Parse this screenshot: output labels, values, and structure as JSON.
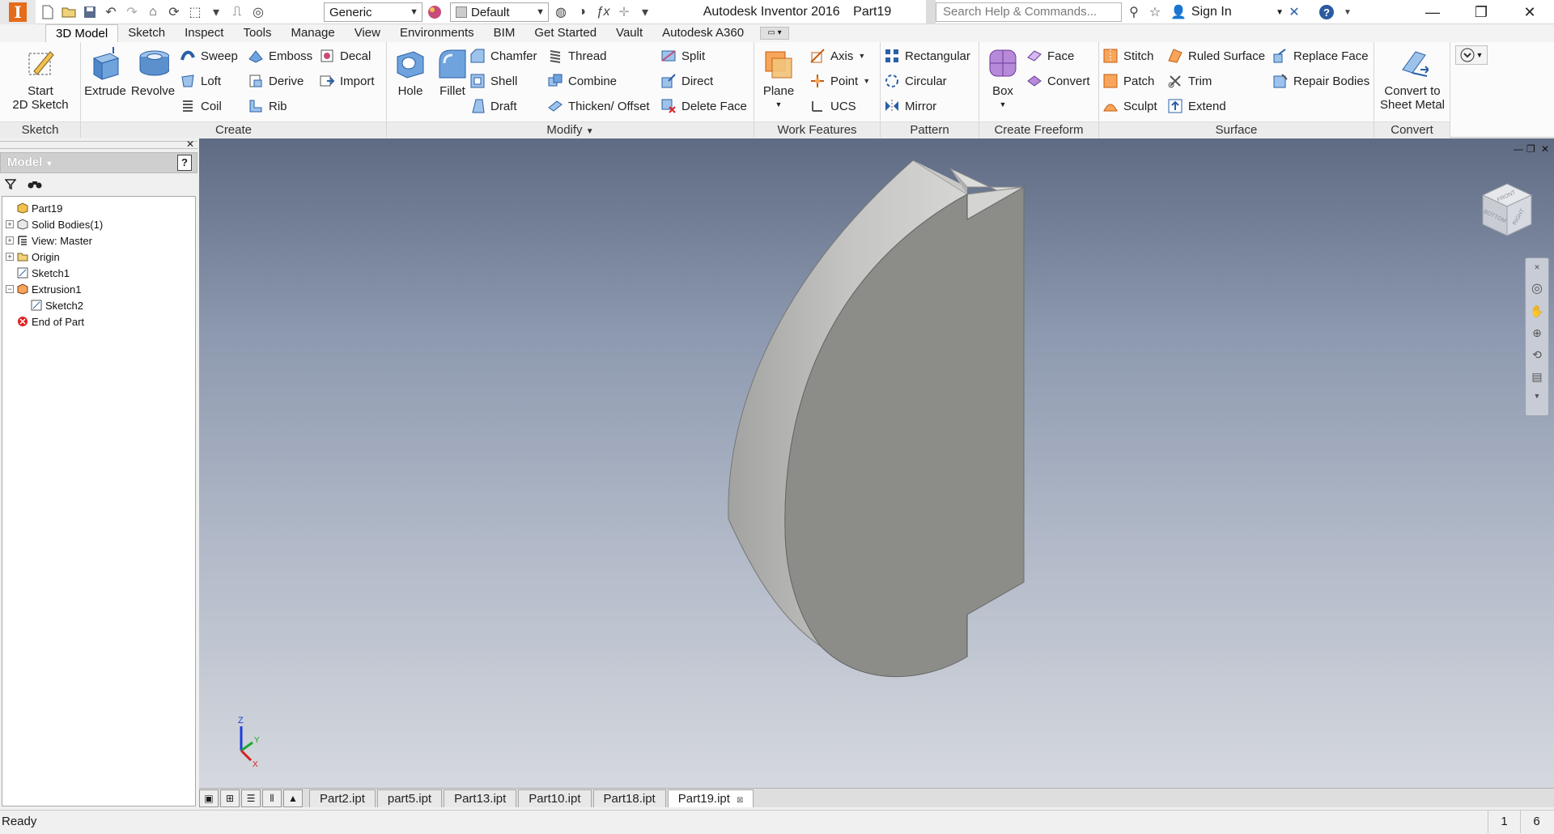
{
  "titlebar": {
    "app_title": "Autodesk Inventor 2016",
    "doc_title": "Part19",
    "material_combo": "Generic",
    "appearance_combo": "Default",
    "search_placeholder": "Search Help & Commands...",
    "sign_in": "Sign In"
  },
  "ribbon_tabs": [
    "3D Model",
    "Sketch",
    "Inspect",
    "Tools",
    "Manage",
    "View",
    "Environments",
    "BIM",
    "Get Started",
    "Vault",
    "Autodesk A360"
  ],
  "panels": {
    "sketch": {
      "title": "Sketch",
      "start_sketch_l1": "Start",
      "start_sketch_l2": "2D Sketch"
    },
    "create": {
      "title": "Create",
      "extrude": "Extrude",
      "revolve": "Revolve",
      "sweep": "Sweep",
      "loft": "Loft",
      "coil": "Coil",
      "emboss": "Emboss",
      "derive": "Derive",
      "rib": "Rib",
      "decal": "Decal",
      "import": "Import"
    },
    "modify": {
      "title": "Modify",
      "hole": "Hole",
      "fillet": "Fillet",
      "chamfer": "Chamfer",
      "shell": "Shell",
      "draft": "Draft",
      "thread": "Thread",
      "combine": "Combine",
      "thicken": "Thicken/ Offset",
      "split": "Split",
      "direct": "Direct",
      "delete_face": "Delete Face"
    },
    "work_features": {
      "title": "Work Features",
      "plane": "Plane",
      "axis": "Axis",
      "point": "Point",
      "ucs": "UCS"
    },
    "pattern": {
      "title": "Pattern",
      "rectangular": "Rectangular",
      "circular": "Circular",
      "mirror": "Mirror"
    },
    "freeform": {
      "title": "Create Freeform",
      "box": "Box",
      "face": "Face",
      "convert": "Convert"
    },
    "surface": {
      "title": "Surface",
      "stitch": "Stitch",
      "patch": "Patch",
      "sculpt": "Sculpt",
      "ruled_surface": "Ruled Surface",
      "trim": "Trim",
      "extend": "Extend",
      "replace_face": "Replace Face",
      "repair_bodies": "Repair Bodies"
    },
    "convert": {
      "title": "Convert",
      "sheet_metal_l1": "Convert to",
      "sheet_metal_l2": "Sheet Metal"
    }
  },
  "browser": {
    "title": "Model",
    "help": "?",
    "tree": [
      {
        "label": "Part19",
        "depth": 0,
        "expander": "",
        "icon": "part-icon"
      },
      {
        "label": "Solid Bodies(1)",
        "depth": 0,
        "expander": "+",
        "icon": "solid-bodies-icon"
      },
      {
        "label": "View: Master",
        "depth": 0,
        "expander": "+",
        "icon": "view-rep-icon"
      },
      {
        "label": "Origin",
        "depth": 0,
        "expander": "+",
        "icon": "folder-icon"
      },
      {
        "label": "Sketch1",
        "depth": 0,
        "expander": "",
        "icon": "sketch-icon"
      },
      {
        "label": "Extrusion1",
        "depth": 0,
        "expander": "−",
        "icon": "extrusion-icon"
      },
      {
        "label": "Sketch2",
        "depth": 1,
        "expander": "",
        "icon": "sketch-icon"
      },
      {
        "label": "End of Part",
        "depth": 0,
        "expander": "",
        "icon": "end-of-part-icon"
      }
    ]
  },
  "viewcube": {
    "top_label": "FRONT",
    "side_label": "BOTTOM",
    "right_label": "RIGHT"
  },
  "axes": {
    "z": "Z",
    "y": "Y",
    "x": "X"
  },
  "document_tabs": [
    {
      "label": "Part2.ipt",
      "active": false
    },
    {
      "label": "part5.ipt",
      "active": false
    },
    {
      "label": "Part13.ipt",
      "active": false
    },
    {
      "label": "Part10.ipt",
      "active": false
    },
    {
      "label": "Part18.ipt",
      "active": false
    },
    {
      "label": "Part19.ipt",
      "active": true
    }
  ],
  "status": {
    "text": "Ready",
    "count1": "1",
    "count2": "6"
  },
  "colors": {
    "accent_tab_border": "#c5c5c5",
    "model_face_light": "#c9c9c9",
    "model_face_dark": "#8c8c89",
    "viewport_top": "#5f6b83",
    "viewport_bottom": "#d5d8de"
  }
}
